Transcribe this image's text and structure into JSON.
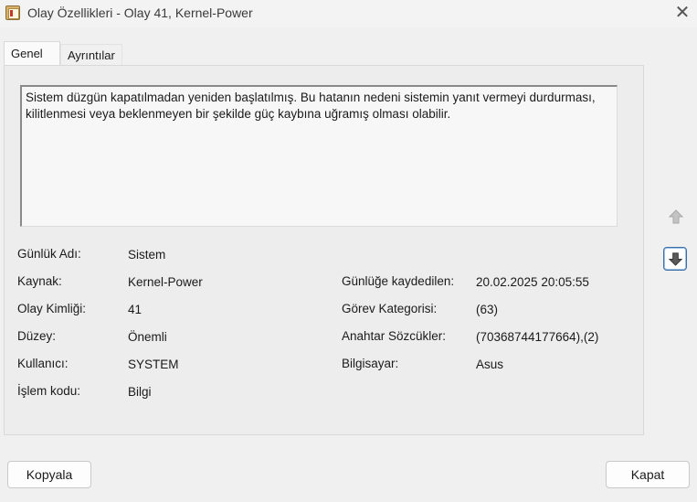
{
  "window": {
    "title": "Olay Özellikleri - Olay 41, Kernel-Power",
    "icon": "event-log-icon",
    "close_glyph": "✕"
  },
  "tabs": [
    {
      "label": "Genel",
      "active": true
    },
    {
      "label": "Ayrıntılar",
      "active": false
    }
  ],
  "description": "Sistem düzgün kapatılmadan yeniden başlatılmış. Bu hatanın nedeni sistemin yanıt vermeyi durdurması, kilitlenmesi veya beklenmeyen bir şekilde güç kaybına uğramış olması olabilir.",
  "fields_left": [
    {
      "label": "Günlük Adı:",
      "value": "Sistem"
    },
    {
      "label": "Kaynak:",
      "value": "Kernel-Power"
    },
    {
      "label": "Olay Kimliği:",
      "value": "41"
    },
    {
      "label": "Düzey:",
      "value": "Önemli"
    },
    {
      "label": "Kullanıcı:",
      "value": "SYSTEM"
    },
    {
      "label": "İşlem kodu:",
      "value": "Bilgi"
    }
  ],
  "fields_right": [
    {
      "label": "Günlüğe kaydedilen:",
      "value": "20.02.2025 20:05:55"
    },
    {
      "label": "Görev Kategorisi:",
      "value": "(63)"
    },
    {
      "label": "Anahtar Sözcükler:",
      "value": "(70368744177664),(2)"
    },
    {
      "label": "Bilgisayar:",
      "value": "Asus"
    }
  ],
  "side_buttons": {
    "up_icon": "arrow-up-icon",
    "down_icon": "arrow-down-icon"
  },
  "buttons": {
    "copy_label": "Kopyala",
    "close_label": "Kapat"
  }
}
